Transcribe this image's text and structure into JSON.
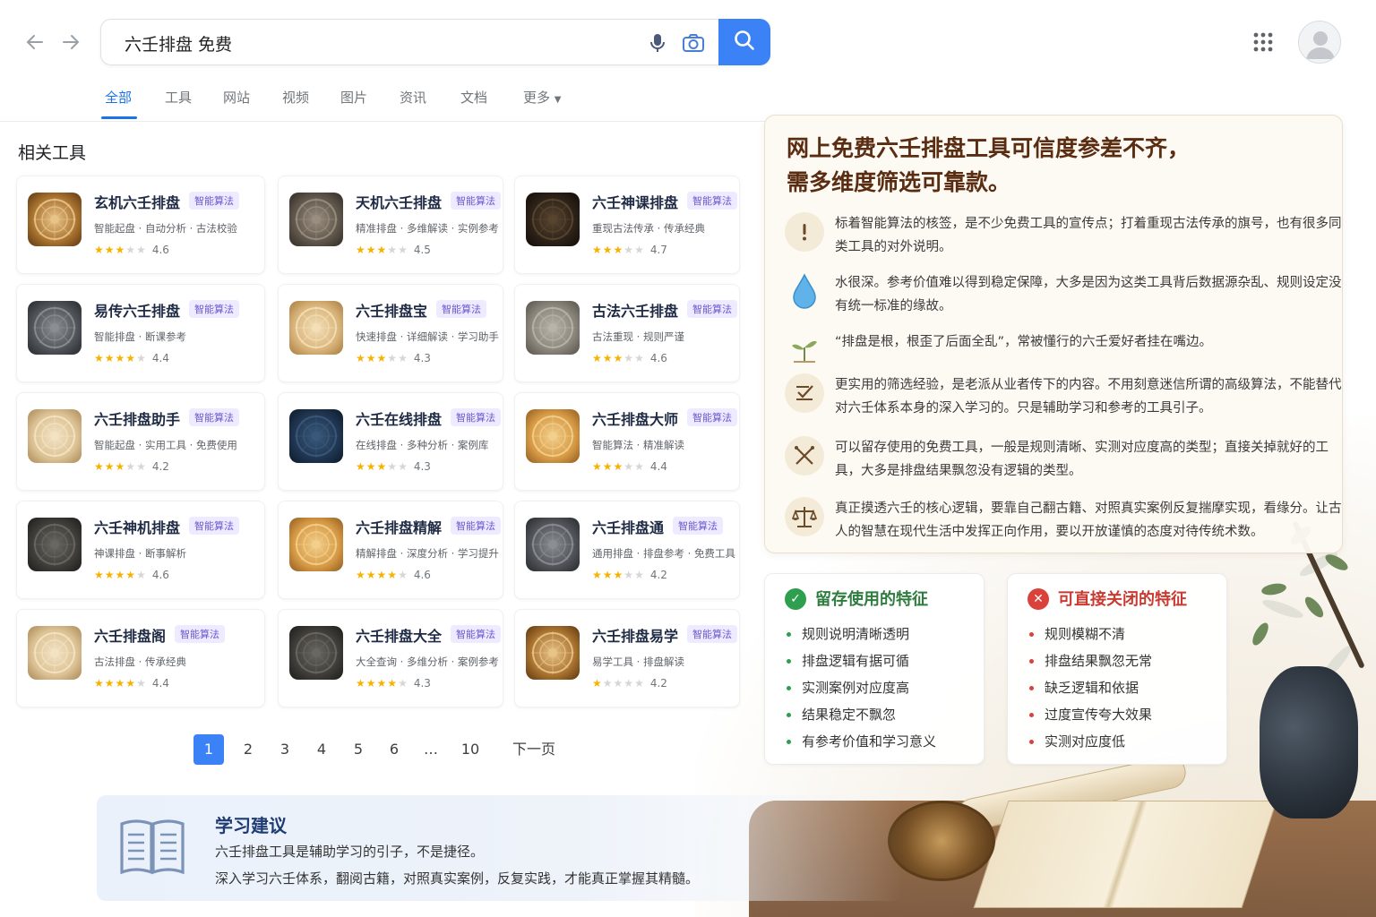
{
  "search": {
    "query": "六壬排盘 免费"
  },
  "tabs": [
    {
      "label": "全部",
      "active": true
    },
    {
      "label": "工具"
    },
    {
      "label": "网站"
    },
    {
      "label": "视频"
    },
    {
      "label": "图片"
    },
    {
      "label": "资讯"
    },
    {
      "label": "文档"
    },
    {
      "label": "更多"
    }
  ],
  "tools_section": {
    "title": "相关工具",
    "cards": [
      {
        "name": "玄机六壬排盘",
        "badge": "智能算法",
        "desc": "智能起盘 · 自动分析 · 古法校验",
        "stars": 2.5,
        "rating": "4.6",
        "icon_theme": "bronze"
      },
      {
        "name": "天机六壬排盘",
        "badge": "智能算法",
        "desc": "精准排盘 · 多维解读 · 实例参考",
        "stars": 2.5,
        "rating": "4.5",
        "icon_theme": "grey-gold"
      },
      {
        "name": "六壬神课排盘",
        "badge": "智能算法",
        "desc": "重现古法传承 · 传承经典",
        "stars": 3,
        "rating": "4.7",
        "icon_theme": "dark"
      },
      {
        "name": "易传六壬排盘",
        "badge": "智能算法",
        "desc": "智能排盘 · 断课参考",
        "stars": 4,
        "rating": "4.4",
        "icon_theme": "slate"
      },
      {
        "name": "六壬排盘宝",
        "badge": "智能算法",
        "desc": "快速排盘 · 详细解读 · 学习助手",
        "stars": 3,
        "rating": "4.3",
        "icon_theme": "taiji"
      },
      {
        "name": "古法六壬排盘",
        "badge": "智能算法",
        "desc": "古法重现 · 规则严谨",
        "stars": 2.5,
        "rating": "4.6",
        "icon_theme": "stone"
      },
      {
        "name": "六壬排盘助手",
        "badge": "智能算法",
        "desc": "智能起盘 · 实用工具 · 免费使用",
        "stars": 3,
        "rating": "4.2",
        "icon_theme": "paper"
      },
      {
        "name": "六壬在线排盘",
        "badge": "智能算法",
        "desc": "在线排盘 · 多种分析 · 案例库",
        "stars": 3,
        "rating": "4.3",
        "icon_theme": "navy"
      },
      {
        "name": "六壬排盘大师",
        "badge": "智能算法",
        "desc": "智能算法 · 精准解读",
        "stars": 3,
        "rating": "4.4",
        "icon_theme": "amber"
      },
      {
        "name": "六壬神机排盘",
        "badge": "智能算法",
        "desc": "神课排盘 · 断事解析",
        "stars": 4,
        "rating": "4.6",
        "icon_theme": "charcoal"
      },
      {
        "name": "六壬排盘精解",
        "badge": "智能算法",
        "desc": "精解排盘 · 深度分析 · 学习提升",
        "stars": 4,
        "rating": "4.6",
        "icon_theme": "amber"
      },
      {
        "name": "六壬排盘通",
        "badge": "智能算法",
        "desc": "通用排盘 · 排盘参考 · 免费工具",
        "stars": 3,
        "rating": "4.2",
        "icon_theme": "slate"
      },
      {
        "name": "六壬排盘阁",
        "badge": "智能算法",
        "desc": "古法排盘 · 传承经典",
        "stars": 4,
        "rating": "4.4",
        "icon_theme": "paper"
      },
      {
        "name": "六壬排盘大全",
        "badge": "智能算法",
        "desc": "大全查询 · 多维分析 · 案例参考",
        "stars": 4,
        "rating": "4.3",
        "icon_theme": "charcoal"
      },
      {
        "name": "六壬排盘易学",
        "badge": "智能算法",
        "desc": "易学工具 · 排盘解读",
        "stars": 1,
        "rating": "4.2",
        "icon_theme": "bronze"
      }
    ]
  },
  "pagination": {
    "pages": [
      "1",
      "2",
      "3",
      "4",
      "5",
      "6",
      "…",
      "10"
    ],
    "current": "1",
    "next_label": "下一页"
  },
  "learning": {
    "title": "学习建议",
    "line1": "六壬排盘工具是辅助学习的引子，不是捷径。",
    "line2": "深入学习六壬体系，翻阅古籍，对照真实案例，反复实践，才能真正掌握其精髓。"
  },
  "panel": {
    "title_line1": "网上免费六壬排盘工具可信度参差不齐，",
    "title_line2": "需多维度筛选可靠款。",
    "points": [
      {
        "icon": "exclamation-icon",
        "text": "标着智能算法的核签，是不少免费工具的宣传点；打着重现古法传承的旗号，也有很多同类工具的对外说明。"
      },
      {
        "icon": "water-drop-icon",
        "text": "水很深。参考价值难以得到稳定保障，大多是因为这类工具背后数据源杂乱、规则设定没有统一标准的缘故。"
      },
      {
        "icon": "sprout-icon",
        "text": "“排盘是根，根歪了后面全乱”，常被懂行的六壬爱好者挂在嘴边。"
      },
      {
        "icon": "checklist-icon",
        "text": "更实用的筛选经验，是老派从业者传下的内容。不用刻意迷信所谓的高级算法，不能替代对六壬体系本身的深入学习的。只是辅助学习和参考的工具引子。"
      },
      {
        "icon": "cross-tools-icon",
        "text": "可以留存使用的免费工具，一般是规则清晰、实测对应度高的类型；直接关掉就好的工具，大多是排盘结果飘忽没有逻辑的类型。"
      },
      {
        "icon": "balance-scale-icon",
        "text": "真正摸透六壬的核心逻辑，要靠自己翻古籍、对照真实案例反复揣摩实现，看缘分。让古人的智慧在现代生活中发挥正向作用，要以开放谨慎的态度对待传统术数。"
      }
    ]
  },
  "keep_features": {
    "title": "留存使用的特征",
    "color": "#2e9e4f",
    "items": [
      "规则说明清晰透明",
      "排盘逻辑有据可循",
      "实测案例对应度高",
      "结果稳定不飘忽",
      "有参考价值和学习意义"
    ]
  },
  "close_features": {
    "title": "可直接关闭的特征",
    "color": "#d9413a",
    "items": [
      "规则模糊不清",
      "排盘结果飘忽无常",
      "缺乏逻辑和依据",
      "过度宣传夸大效果",
      "实测对应度低"
    ]
  },
  "colors": {
    "accent_blue": "#3b82f6",
    "link_blue": "#1a73e8",
    "panel_title_brown": "#5a2d12",
    "star": "#f5b301"
  }
}
